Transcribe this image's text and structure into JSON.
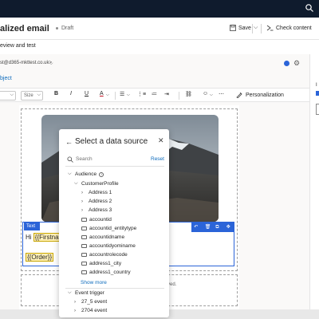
{
  "header": {
    "title": "alized email",
    "status": "Draft",
    "save_label": "Save",
    "check_label": "Check content"
  },
  "review_step": "eview and test",
  "from": {
    "address": "st@d365-mkttest.co.uk>"
  },
  "subject_label": "bject",
  "toolbar": {
    "size_placeholder": "Size",
    "bold": "B",
    "italic": "I",
    "underline": "U",
    "font_color": "A",
    "personalization_label": "Personalization"
  },
  "content": {
    "text_tag": "Text",
    "greeting_prefix": "Hi ",
    "token_firstname": "{{Firstna",
    "token_order": "{{Order}}",
    "footer_fragment": "ved."
  },
  "right_panel": {
    "label": "I"
  },
  "flyout": {
    "title": "Select a data source",
    "search_placeholder": "Search",
    "reset_label": "Reset",
    "tree": {
      "audience": "Audience",
      "customer_profile": "CustomerProfile",
      "address_1": "Address 1",
      "address_2": "Address 2",
      "address_3": "Address 3",
      "fields": [
        "accountid",
        "accountid_entitytype",
        "accountidname",
        "accountidyominame",
        "accountrolecode",
        "address1_city",
        "address1_country"
      ],
      "show_more": "Show more",
      "event_trigger": "Event trigger",
      "event_1": "27_5 event",
      "event_2": "2704 event"
    }
  },
  "colors": {
    "accent": "#2b64d8",
    "link": "#0f6cbd",
    "topbar": "#0f1b2d",
    "token_bg": "#fff1b8"
  }
}
